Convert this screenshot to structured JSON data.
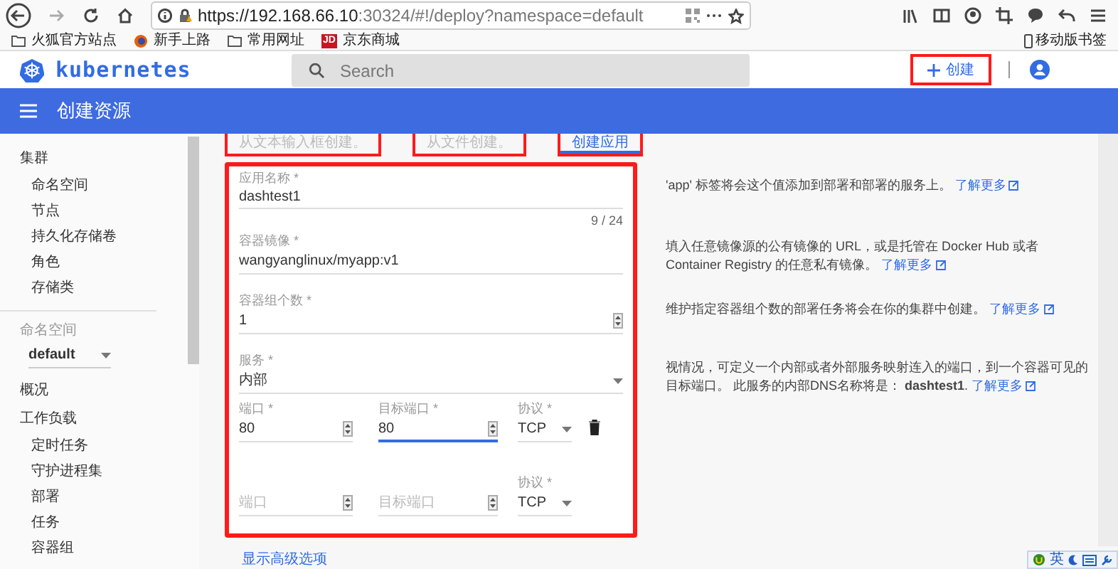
{
  "browser": {
    "url_host": "https://192.168.66.10",
    "url_rest": ":30324/#!/deploy?namespace=default",
    "bookmarks": [
      {
        "kind": "folder",
        "label": "火狐官方站点"
      },
      {
        "kind": "firefox",
        "label": "新手上路"
      },
      {
        "kind": "folder",
        "label": "常用网址"
      },
      {
        "kind": "jd",
        "label": "京东商城",
        "badge": "JD"
      }
    ],
    "mobile_bookmarks": "移动版书签"
  },
  "header": {
    "brand": "kubernetes",
    "search_placeholder": "Search",
    "create_button": "创建"
  },
  "toolbar": {
    "title": "创建资源"
  },
  "tabs": [
    {
      "label": "从文本输入框创建。",
      "selected": false
    },
    {
      "label": "从文件创建。",
      "selected": false
    },
    {
      "label": "创建应用",
      "selected": true
    }
  ],
  "sidebar": {
    "cluster": {
      "title": "集群",
      "items": [
        "命名空间",
        "节点",
        "持久化存储卷",
        "角色",
        "存储类"
      ]
    },
    "namespace": {
      "label": "命名空间",
      "value": "default"
    },
    "overview": "概况",
    "workloads": {
      "title": "工作负载",
      "items": [
        "定时任务",
        "守护进程集",
        "部署",
        "任务",
        "容器组"
      ]
    }
  },
  "form": {
    "app_name": {
      "label": "应用名称 *",
      "value": "dashtest1",
      "counter": "9 / 24"
    },
    "image": {
      "label": "容器镜像 *",
      "value": "wangyanglinux/myapp:v1"
    },
    "pods": {
      "label": "容器组个数 *",
      "value": "1"
    },
    "service": {
      "label": "服务 *",
      "value": "内部"
    },
    "ports": [
      {
        "port_label": "端口 *",
        "port": "80",
        "target_label": "目标端口 *",
        "target": "80",
        "protocol_label": "协议 *",
        "protocol": "TCP",
        "focused": true,
        "deletable": true
      },
      {
        "port_placeholder": "端口",
        "target_placeholder": "目标端口",
        "protocol_label": "协议 *",
        "protocol": "TCP",
        "focused": false,
        "deletable": false
      }
    ]
  },
  "help": [
    {
      "text": "'app' 标签将会这个值添加到部署和部署的服务上。",
      "link": "了解更多"
    },
    {
      "text": "填入任意镜像源的公有镜像的 URL，或是托管在 Docker Hub 或者 Container Registry 的任意私有镜像。",
      "link": "了解更多"
    },
    {
      "text": "维护指定容器组个数的部署任务将会在你的集群中创建。",
      "link": "了解更多"
    },
    {
      "text": "视情况，可定义一个内部或者外部服务映射连入的端口，到一个容器可见的目标端口。 此服务的内部DNS名称将是： **dashtest1**.",
      "link": "了解更多"
    }
  ],
  "advanced_link": "显示高级选项",
  "ime": {
    "label": "英"
  }
}
